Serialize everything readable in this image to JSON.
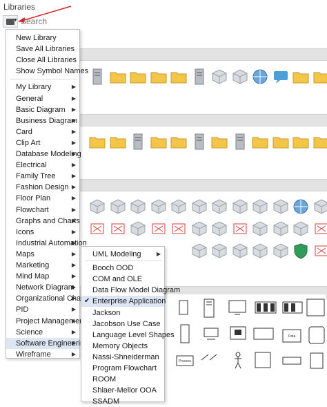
{
  "panel": {
    "title": "Libraries"
  },
  "search": {
    "placeholder": "Search"
  },
  "menu": {
    "top_items": [
      "New Library",
      "Save All Libraries",
      "Close All Libraries",
      "Show Symbol Names"
    ],
    "categories": [
      {
        "label": "My Library"
      },
      {
        "label": "General"
      },
      {
        "label": "Basic Diagram"
      },
      {
        "label": "Business Diagram"
      },
      {
        "label": "Card"
      },
      {
        "label": "Clip Art"
      },
      {
        "label": "Database Modeling"
      },
      {
        "label": "Electrical"
      },
      {
        "label": "Family Tree"
      },
      {
        "label": "Fashion Design"
      },
      {
        "label": "Floor Plan"
      },
      {
        "label": "Flowchart"
      },
      {
        "label": "Graphs and Charts"
      },
      {
        "label": "Icons"
      },
      {
        "label": "Industrial Automation"
      },
      {
        "label": "Maps"
      },
      {
        "label": "Marketing"
      },
      {
        "label": "Mind Map"
      },
      {
        "label": "Network Diagram"
      },
      {
        "label": "Organizational Chart"
      },
      {
        "label": "PID"
      },
      {
        "label": "Project Management"
      },
      {
        "label": "Science"
      },
      {
        "label": "Software Engineering"
      },
      {
        "label": "Wireframe"
      }
    ],
    "highlighted": "Software Engineering"
  },
  "submenu": {
    "items": [
      {
        "label": "UML Modeling",
        "has_sub": true,
        "checked": false
      },
      {
        "label": "Booch OOD",
        "has_sub": false,
        "checked": false
      },
      {
        "label": "COM and OLE",
        "has_sub": false,
        "checked": false
      },
      {
        "label": "Data Flow Model Diagram",
        "has_sub": false,
        "checked": false
      },
      {
        "label": "Enterprise Application",
        "has_sub": false,
        "checked": true
      },
      {
        "label": "Jackson",
        "has_sub": false,
        "checked": false
      },
      {
        "label": "Jacobson Use Case",
        "has_sub": false,
        "checked": false
      },
      {
        "label": "Language Level Shapes",
        "has_sub": false,
        "checked": false
      },
      {
        "label": "Memory Objects",
        "has_sub": false,
        "checked": false
      },
      {
        "label": "Nassi-Shneiderman",
        "has_sub": false,
        "checked": false
      },
      {
        "label": "Program Flowchart",
        "has_sub": false,
        "checked": false
      },
      {
        "label": "ROOM",
        "has_sub": false,
        "checked": false
      },
      {
        "label": "Shlaer-Mellor OOA",
        "has_sub": false,
        "checked": false
      },
      {
        "label": "SSADM",
        "has_sub": false,
        "checked": false
      }
    ]
  },
  "colors": {
    "accent_arrow": "#d42b2b",
    "highlight": "#dce6f5",
    "folder": "#f3c64a",
    "server": "#b9bcc2",
    "network": "#6aa6d8"
  },
  "canvas_shapes": [
    "Process",
    "Data"
  ]
}
